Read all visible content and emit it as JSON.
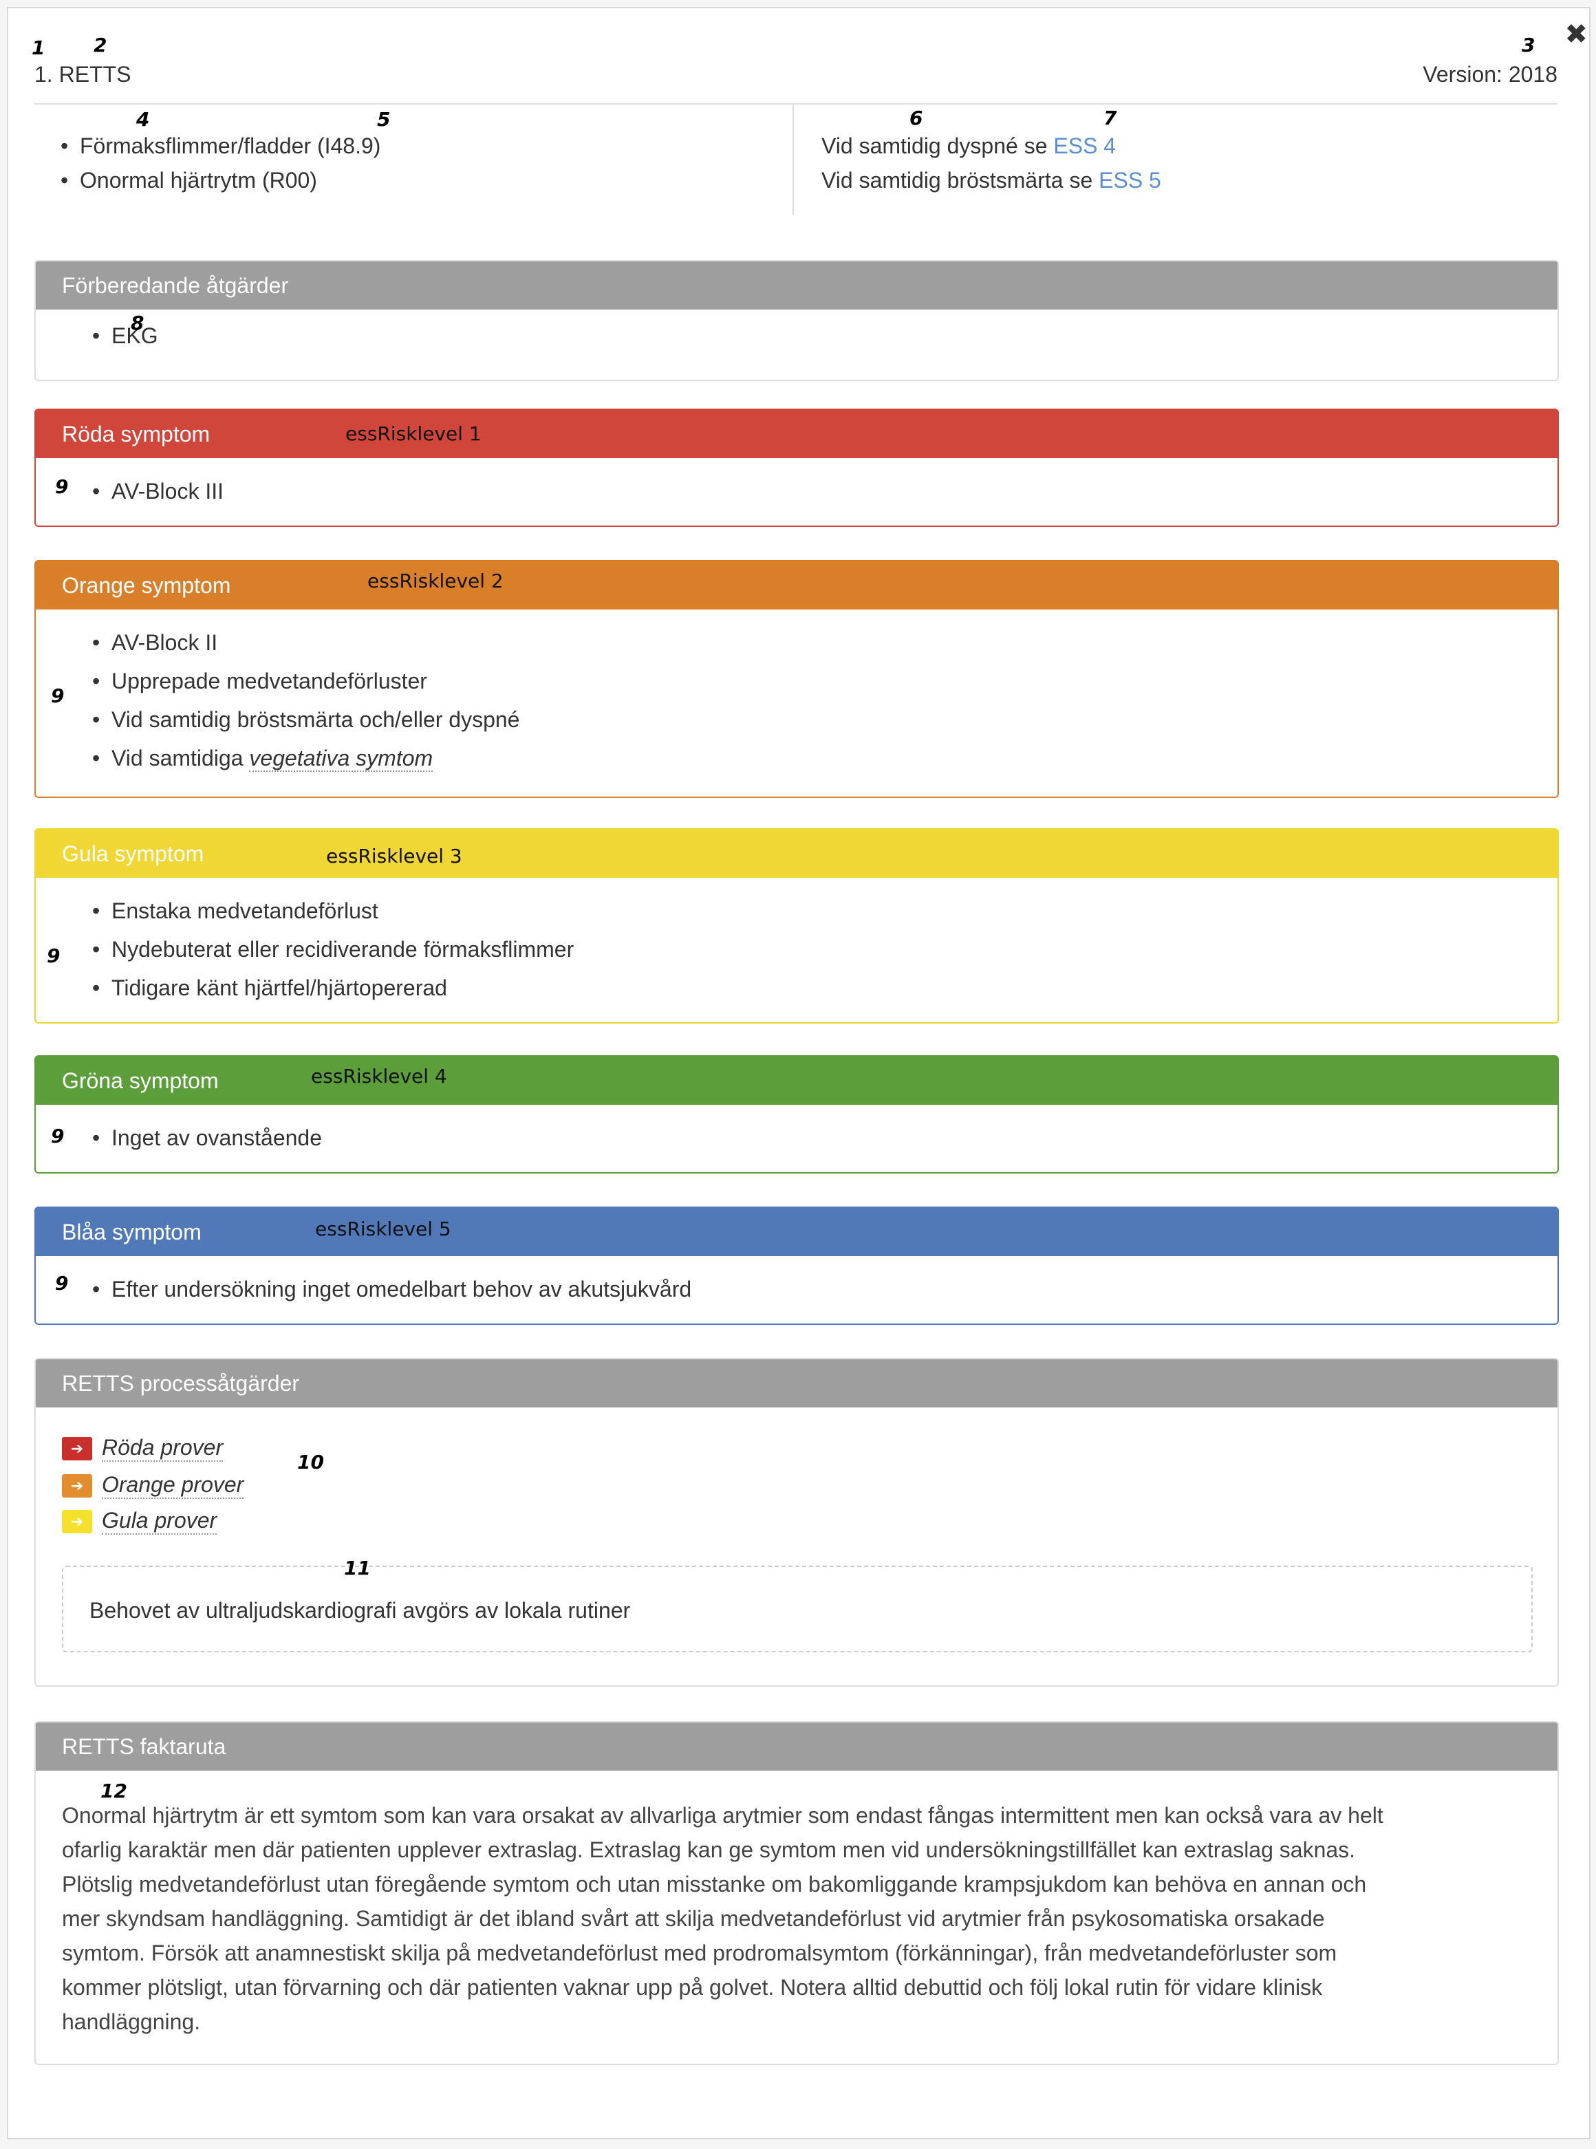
{
  "annotations": [
    "1",
    "2",
    "3",
    "4",
    "5",
    "6",
    "7",
    "8",
    "9",
    "10",
    "11",
    "12"
  ],
  "header": {
    "title": "1. RETTS",
    "version": "Version: 2018",
    "close_icon": "close-icon"
  },
  "diagnoses": [
    "Förmaksflimmer/fladder (I48.9)",
    "Onormal hjärtrytm (R00)"
  ],
  "see_also": [
    {
      "prefix": "Vid samtidig dyspné se ",
      "link": "ESS 4"
    },
    {
      "prefix": "Vid samtidig bröstsmärta se ",
      "link": "ESS 5"
    }
  ],
  "preparatory": {
    "title": "Förberedande åtgärder",
    "items": [
      "EKG"
    ]
  },
  "levels": {
    "red": {
      "title": "Röda symptom",
      "risk": "essRisklevel 1",
      "items": [
        "AV-Block III"
      ],
      "color": "#d0463a"
    },
    "orange": {
      "title": "Orange symptom",
      "risk": "essRisklevel 2",
      "items": [
        "AV-Block II",
        "Upprepade medvetandeförluster",
        "Vid samtidig bröstsmärta och/eller dyspné"
      ],
      "last_prefix": "Vid samtidiga ",
      "last_link": "vegetativa symtom",
      "color": "#d97f2a"
    },
    "yellow": {
      "title": "Gula symptom",
      "risk": "essRisklevel 3",
      "items": [
        "Enstaka medvetandeförlust",
        "Nydebuterat eller recidiverande förmaksflimmer",
        "Tidigare känt hjärtfel/hjärtopererad"
      ],
      "color": "#f1d733"
    },
    "green": {
      "title": "Gröna symptom",
      "risk": "essRisklevel 4",
      "items": [
        "Inget av ovanstående"
      ],
      "color": "#5b9e3a"
    },
    "blue": {
      "title": "Blåa symptom",
      "risk": "essRisklevel 5",
      "items": [
        "Efter undersökning inget omedelbart behov av akutsjukvård"
      ],
      "color": "#5179b8"
    }
  },
  "process": {
    "title": "RETTS processåtgärder",
    "tests": [
      {
        "label": "Röda prover",
        "color": "#c9302c"
      },
      {
        "label": "Orange prover",
        "color": "#e38d2f"
      },
      {
        "label": "Gula prover",
        "color": "#f5e02b"
      }
    ],
    "note": "Behovet av ultraljudskardiografi avgörs av lokala rutiner"
  },
  "facts": {
    "title": "RETTS faktaruta",
    "lines": [
      "Onormal hjärtrytm är ett symtom som kan vara orsakat av allvarliga arytmier som endast fångas intermittent men kan också vara av helt",
      "ofarlig karaktär men där patienten upplever extraslag. Extraslag kan ge symtom men vid undersökningstillfället kan extraslag saknas.",
      "Plötslig medvetandeförlust utan föregående symtom och utan misstanke om bakomliggande krampsjukdom kan behöva en annan och",
      "mer skyndsam handläggning. Samtidigt är det ibland svårt att skilja medvetandeförlust vid arytmier från psykosomatiska orsakade",
      "symtom. Försök att anamnestiskt skilja på medvetandeförlust med prodromalsymtom (förkänningar), från medvetandeförluster som",
      "kommer plötsligt, utan förvarning och där patienten vaknar upp på golvet. Notera alltid debuttid och följ lokal rutin för vidare klinisk",
      "handläggning."
    ]
  }
}
